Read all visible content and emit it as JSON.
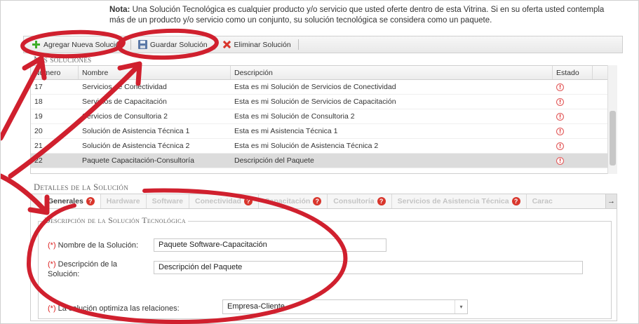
{
  "note": {
    "bold": "Nota:",
    "text": "Una Solución Tecnológica es cualquier producto y/o servicio que usted oferte dentro de esta Vitrina. Si en su oferta usted contempla más de un producto y/o servicio como un conjunto, su solución tecnológica se considera como un paquete."
  },
  "toolbar": {
    "add_label": "Agregar Nueva Solución",
    "save_label": "Guardar Solución",
    "delete_label": "Eliminar Solución"
  },
  "solutions": {
    "legend": "Mis soluciones",
    "columns": [
      "Número",
      "Nombre",
      "Descripción",
      "Estado"
    ],
    "rows": [
      {
        "numero": "17",
        "nombre": "Servicios de Conectividad",
        "descripcion": "Esta es mi Solución de Servicios de Conectividad",
        "estado": "!"
      },
      {
        "numero": "18",
        "nombre": "Servicios de Capacitación",
        "descripcion": "Esta es mi Solución de Servicios de Capacitación",
        "estado": "!"
      },
      {
        "numero": "19",
        "nombre": "Servicios de Consultoria 2",
        "descripcion": "Esta es mi Solución de Consultoria 2",
        "estado": "!"
      },
      {
        "numero": "20",
        "nombre": "Solución de Asistencia Técnica 1",
        "descripcion": "Esta es mi Asistencia Técnica 1",
        "estado": "!"
      },
      {
        "numero": "21",
        "nombre": "Solución de Asistencia Técnica 2",
        "descripcion": "Esta es mi Solución de Asistencia Técnica 2",
        "estado": "!"
      },
      {
        "numero": "22",
        "nombre": "Paquete Capacitación-Consultoría",
        "descripcion": "Descripción del Paquete",
        "estado": "!"
      }
    ]
  },
  "details": {
    "legend": "Detalles de la Solución",
    "tabs": [
      {
        "label": "Generales",
        "help": "?"
      },
      {
        "label": "Hardware",
        "help": ""
      },
      {
        "label": "Software",
        "help": ""
      },
      {
        "label": "Conectividad",
        "help": "?"
      },
      {
        "label": "Capacitación",
        "help": "?"
      },
      {
        "label": "Consultoría",
        "help": "?"
      },
      {
        "label": "Servicios de Asistencia Técnica",
        "help": "?"
      },
      {
        "label": "Carac",
        "help": ""
      }
    ],
    "arrow_left": "←",
    "arrow_right": "→",
    "section_legend": "Descripción de la Solución Tecnológica",
    "required_mark": "(*)",
    "name_label": "Nombre de la Solución:",
    "name_value": "Paquete Software-Capacitación",
    "desc_label_1": "Descripción de la",
    "desc_label_2": "Solución:",
    "desc_value": "Descripción del Paquete",
    "relation_label": "La solución optimiza las relaciones:",
    "relation_value": "Empresa-Cliente",
    "select_arrow": "▾"
  },
  "colors": {
    "annotation_red": "#d0202e",
    "add_green": "#3fae2a",
    "delete_red": "#d9362c",
    "selected_row": "#dcdcdc"
  }
}
